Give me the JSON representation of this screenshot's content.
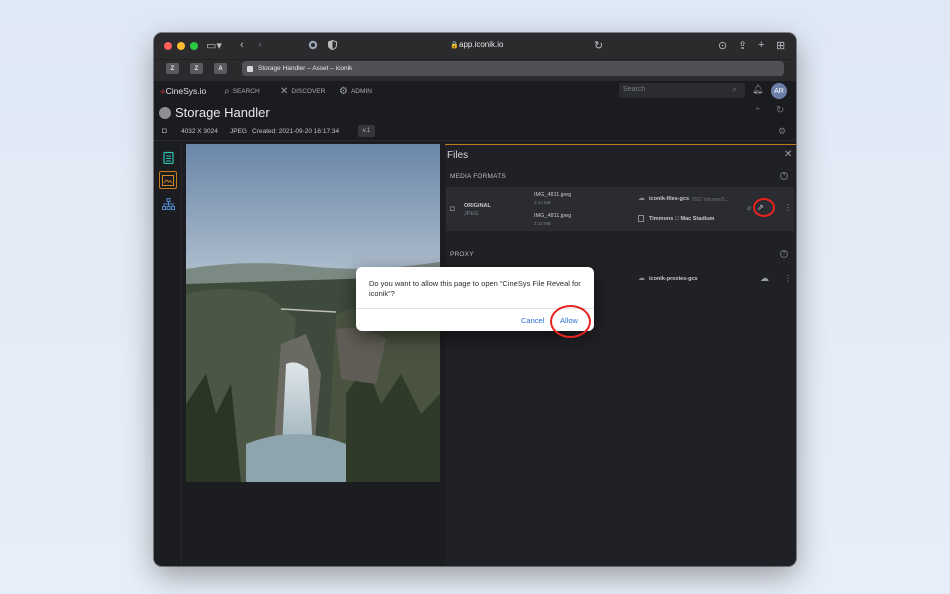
{
  "browser": {
    "url": "app.iconik.io",
    "tab_title": "Storage Handler – Asset – iconik",
    "favorites": [
      "Z",
      "Z",
      "A"
    ]
  },
  "app": {
    "brand": "CineSys.io",
    "nav": [
      "SEARCH",
      "DISCOVER",
      "ADMIN"
    ],
    "search_placeholder": "Search",
    "avatar_initials": "AR"
  },
  "asset": {
    "title": "Storage Handler",
    "dimensions": "4032 X 3024",
    "format": "JPEG",
    "created": "Created: 2021-09-20 16:17:34",
    "version": "v.1"
  },
  "files_panel": {
    "title": "Files",
    "media_formats_label": "MEDIA FORMATS",
    "proxy_label": "PROXY",
    "original": {
      "label": "ORIGINAL",
      "sublabel": "JPEG",
      "file1_name": "IMG_4811.jpeg",
      "file1_size": "3.13 MB",
      "file2_name": "IMG_4811.jpeg",
      "file2_size": "3.13 MB",
      "storage1": "iconik-files-gcs",
      "storage1_path": "/ISG Volume/3...",
      "storage2": "Timmons  Mac Stadium"
    },
    "proxy": {
      "storage": "iconik-proxies-gcs"
    }
  },
  "dialog": {
    "message": "Do you want to allow this page to open “CineSys File Reveal for iconik”?",
    "cancel": "Cancel",
    "allow": "Allow"
  },
  "colors": {
    "accent_border": "#c27a1a",
    "highlight": "#e52420",
    "dialog_button": "#2d6fd6"
  }
}
